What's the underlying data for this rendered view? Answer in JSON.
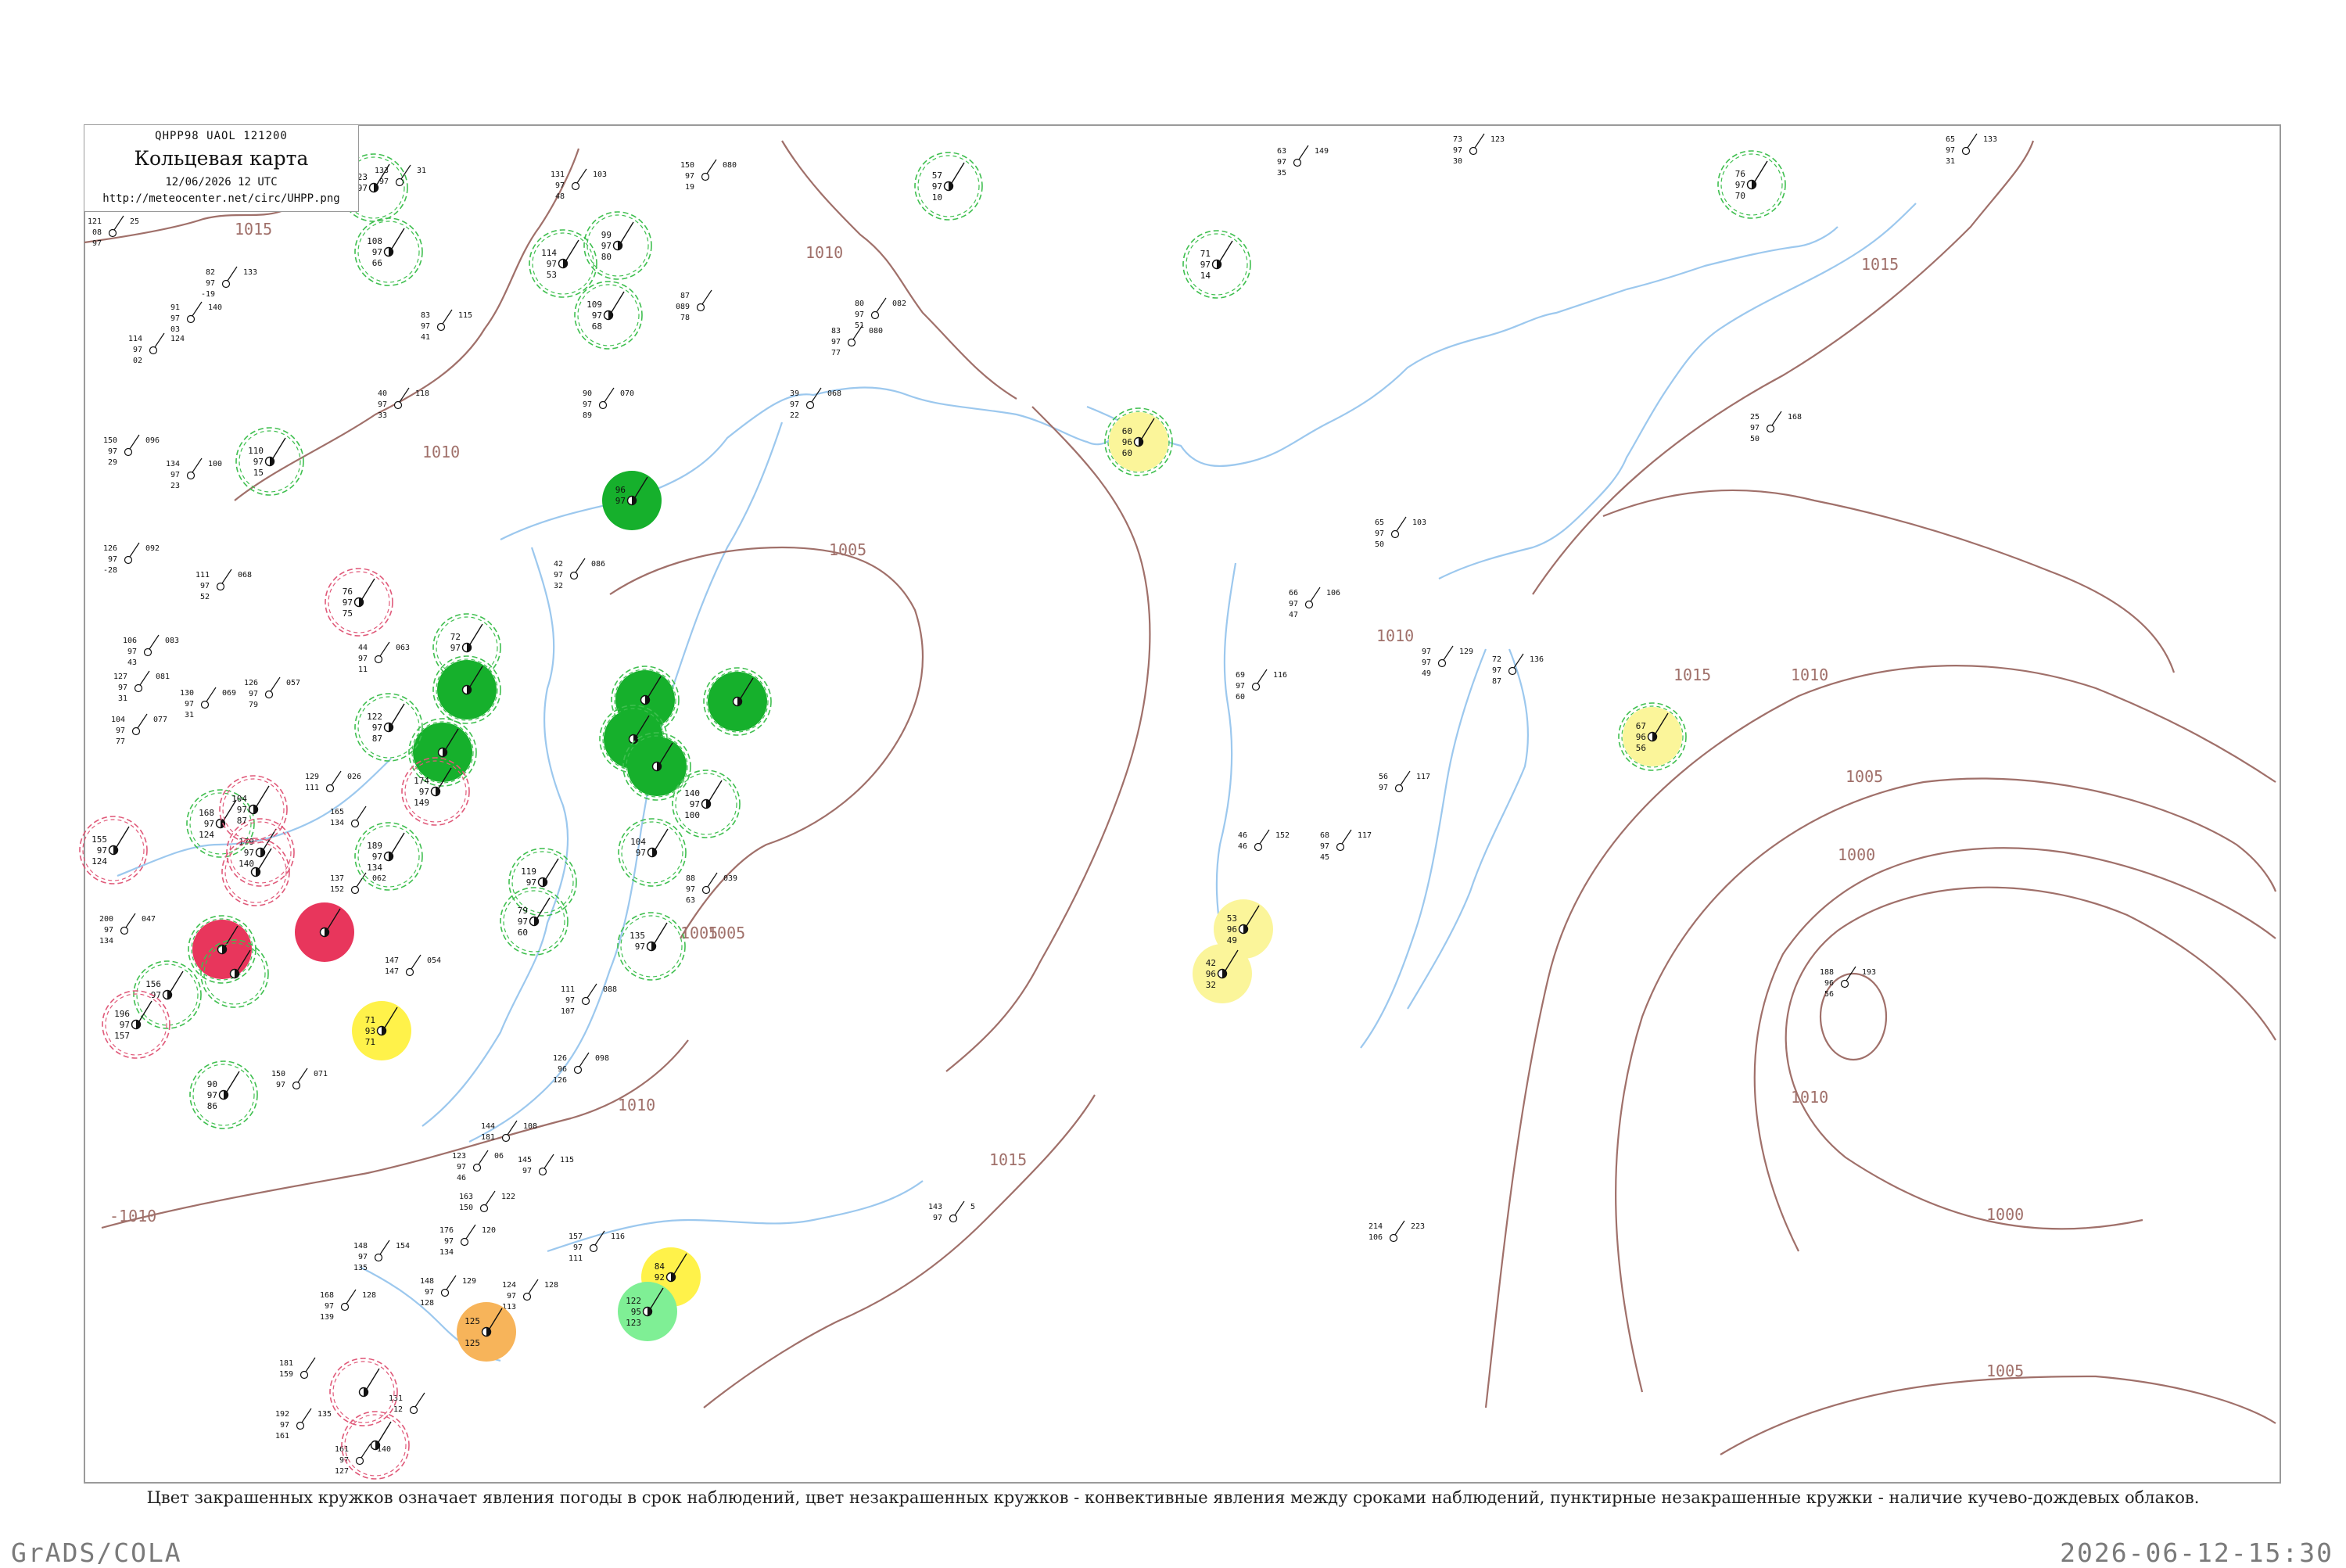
{
  "header": {
    "code": "QHPP98 UAOL 121200",
    "title": "Кольцевая карта",
    "datetime": "12/06/2026 12 UTC",
    "url": "http://meteocenter.net/circ/UHPP.png"
  },
  "caption": "Цвет закрашенных кружков означает явления погоды в срок наблюдений, цвет незакрашенных кружков - конвективные явления между сроками наблюдений, пунктирные незакрашенные кружки - наличие кучево-дождевых облаков.",
  "footer": {
    "software": "GrADS/COLA",
    "timestamp": "2026-06-12-15:30"
  },
  "colors": {
    "isobar": "#a0706a",
    "coast": "#9cc8ee",
    "frame": "#9a9a9a",
    "green": "#16b02c",
    "lime": "#7fef95",
    "yellow": "#fff24a",
    "paleyellow": "#fbf59a",
    "red": "#e8365c",
    "orange": "#f7b45a",
    "ring_green": "#3fbf4f",
    "ring_red": "#e05a7a"
  },
  "isobar_labels": [
    "1015",
    "1010",
    "1010",
    "1005",
    "1005",
    "1010",
    "1010",
    "1015",
    "1015",
    "1010",
    "1005",
    "1000",
    "1000",
    "1005",
    "1010",
    "-1010",
    "1015",
    "1005"
  ],
  "stations": [
    {
      "id": "a1",
      "t": "123",
      "p": "97",
      "d": "",
      "fill": "",
      "ring": "green"
    },
    {
      "id": "a2",
      "t": "108",
      "p": "97",
      "d": "66",
      "fill": "",
      "ring": "green"
    },
    {
      "id": "a3",
      "t": "99",
      "p": "97",
      "d": "80",
      "fill": "",
      "ring": "green"
    },
    {
      "id": "a4",
      "t": "114",
      "p": "97",
      "d": "53",
      "fill": "",
      "ring": "green"
    },
    {
      "id": "a5",
      "t": "109",
      "p": "97",
      "d": "68",
      "fill": "",
      "ring": "green"
    },
    {
      "id": "a6",
      "t": "57",
      "p": "97",
      "d": "10",
      "fill": "",
      "ring": "green"
    },
    {
      "id": "a7",
      "t": "71",
      "p": "97",
      "d": "14",
      "fill": "",
      "ring": "green"
    },
    {
      "id": "a8",
      "t": "76",
      "p": "97",
      "d": "70",
      "fill": "",
      "ring": "green"
    },
    {
      "id": "a9",
      "t": "110",
      "p": "97",
      "d": "15",
      "fill": "",
      "ring": "green"
    },
    {
      "id": "a10",
      "t": "60",
      "p": "96",
      "d": "60",
      "fill": "paleyellow",
      "ring": "green"
    },
    {
      "id": "a11",
      "t": "96",
      "p": "97",
      "d": "",
      "fill": "green",
      "ring": ""
    },
    {
      "id": "a12",
      "t": "76",
      "p": "97",
      "d": "75",
      "fill": "",
      "ring": "red"
    },
    {
      "id": "a13",
      "t": "72",
      "p": "97",
      "d": "",
      "fill": "",
      "ring": "green"
    },
    {
      "id": "a14",
      "t": "",
      "p": "",
      "d": "",
      "fill": "green",
      "ring": "green"
    },
    {
      "id": "a15",
      "t": "",
      "p": "",
      "d": "",
      "fill": "green",
      "ring": "green"
    },
    {
      "id": "a16",
      "t": "",
      "p": "",
      "d": "",
      "fill": "green",
      "ring": "green"
    },
    {
      "id": "a17",
      "t": "",
      "p": "",
      "d": "",
      "fill": "green",
      "ring": "green"
    },
    {
      "id": "a18",
      "t": "",
      "p": "",
      "d": "",
      "fill": "green",
      "ring": "green"
    },
    {
      "id": "a19",
      "t": "",
      "p": "",
      "d": "",
      "fill": "green",
      "ring": "green"
    },
    {
      "id": "a20",
      "t": "122",
      "p": "97",
      "d": "87",
      "fill": "",
      "ring": "green"
    },
    {
      "id": "a21",
      "t": "174",
      "p": "97",
      "d": "149",
      "fill": "",
      "ring": "red"
    },
    {
      "id": "a22",
      "t": "168",
      "p": "97",
      "d": "124",
      "fill": "",
      "ring": "green"
    },
    {
      "id": "a23",
      "t": "179",
      "p": "97",
      "d": "140",
      "fill": "",
      "ring": "red"
    },
    {
      "id": "a24",
      "t": "104",
      "p": "97",
      "d": "87",
      "fill": "",
      "ring": "red"
    },
    {
      "id": "a25",
      "t": "155",
      "p": "97",
      "d": "124",
      "fill": "",
      "ring": "red"
    },
    {
      "id": "a26",
      "t": "189",
      "p": "97",
      "d": "134",
      "fill": "",
      "ring": "green"
    },
    {
      "id": "a27",
      "t": "104",
      "p": "97",
      "d": "",
      "fill": "",
      "ring": "green"
    },
    {
      "id": "a28",
      "t": "119",
      "p": "97",
      "d": "",
      "fill": "",
      "ring": "green"
    },
    {
      "id": "a29",
      "t": "79",
      "p": "97",
      "d": "60",
      "fill": "",
      "ring": "green"
    },
    {
      "id": "a30",
      "t": "135",
      "p": "97",
      "d": "",
      "fill": "",
      "ring": "green"
    },
    {
      "id": "a31",
      "t": "140",
      "p": "97",
      "d": "100",
      "fill": "",
      "ring": "green"
    },
    {
      "id": "a32",
      "t": "",
      "p": "",
      "d": "",
      "fill": "red",
      "ring": "green"
    },
    {
      "id": "a33",
      "t": "",
      "p": "",
      "d": "",
      "fill": "red",
      "ring": ""
    },
    {
      "id": "a34",
      "t": "156",
      "p": "97",
      "d": "",
      "fill": "",
      "ring": "green"
    },
    {
      "id": "a35",
      "t": "196",
      "p": "97",
      "d": "157",
      "fill": "",
      "ring": "red"
    },
    {
      "id": "a36",
      "t": "71",
      "p": "93",
      "d": "71",
      "fill": "yellow",
      "ring": ""
    },
    {
      "id": "a37",
      "t": "90",
      "p": "97",
      "d": "86",
      "fill": "",
      "ring": "green"
    },
    {
      "id": "a38",
      "t": "53",
      "p": "96",
      "d": "49",
      "fill": "paleyellow",
      "ring": ""
    },
    {
      "id": "a39",
      "t": "42",
      "p": "96",
      "d": "32",
      "fill": "paleyellow",
      "ring": ""
    },
    {
      "id": "a40",
      "t": "67",
      "p": "96",
      "d": "56",
      "fill": "paleyellow",
      "ring": "green"
    },
    {
      "id": "a41",
      "t": "84",
      "p": "92",
      "d": "",
      "fill": "yellow",
      "ring": ""
    },
    {
      "id": "a42",
      "t": "122",
      "p": "95",
      "d": "123",
      "fill": "lime",
      "ring": ""
    },
    {
      "id": "a43",
      "t": "125",
      "p": "",
      "d": "125",
      "fill": "orange",
      "ring": ""
    },
    {
      "id": "a44",
      "t": "",
      "p": "",
      "d": "",
      "fill": "",
      "ring": "red"
    },
    {
      "id": "a45",
      "t": "",
      "p": "",
      "d": "",
      "fill": "",
      "ring": "red"
    },
    {
      "id": "a46",
      "t": "",
      "p": "",
      "d": "",
      "fill": "",
      "ring": "red"
    },
    {
      "id": "a47",
      "t": "",
      "p": "",
      "d": "",
      "fill": "",
      "ring": "green"
    }
  ],
  "plain_stations": [
    {
      "v": [
        "133",
        "97",
        "",
        "31"
      ]
    },
    {
      "v": [
        "121",
        "08",
        "97",
        "25"
      ]
    },
    {
      "v": [
        "82",
        "97",
        "-19",
        "133"
      ]
    },
    {
      "v": [
        "91",
        "97",
        "03",
        "140"
      ]
    },
    {
      "v": [
        "114",
        "97",
        "02",
        "124"
      ]
    },
    {
      "v": [
        "83",
        "97",
        "41",
        "115"
      ]
    },
    {
      "v": [
        "131",
        "97",
        "48",
        "103"
      ]
    },
    {
      "v": [
        "150",
        "97",
        "19",
        "080"
      ]
    },
    {
      "v": [
        "87",
        "089",
        "78",
        ""
      ]
    },
    {
      "v": [
        "80",
        "97",
        "51",
        "082"
      ]
    },
    {
      "v": [
        "83",
        "97",
        "77",
        "080"
      ]
    },
    {
      "v": [
        "90",
        "97",
        "89",
        "070"
      ]
    },
    {
      "v": [
        "39",
        "97",
        "22",
        "068"
      ]
    },
    {
      "v": [
        "40",
        "97",
        "33",
        "118"
      ]
    },
    {
      "v": [
        "150",
        "97",
        "29",
        "096"
      ]
    },
    {
      "v": [
        "134",
        "97",
        "23",
        "100"
      ]
    },
    {
      "v": [
        "63",
        "97",
        "35",
        "149"
      ]
    },
    {
      "v": [
        "73",
        "97",
        "30",
        "123"
      ]
    },
    {
      "v": [
        "65",
        "97",
        "31",
        "133"
      ]
    },
    {
      "v": [
        "25",
        "97",
        "50",
        "168"
      ]
    },
    {
      "v": [
        "65",
        "97",
        "50",
        "103"
      ]
    },
    {
      "v": [
        "66",
        "97",
        "47",
        "106"
      ]
    },
    {
      "v": [
        "97",
        "97",
        "49",
        "129"
      ]
    },
    {
      "v": [
        "72",
        "97",
        "87",
        "136"
      ]
    },
    {
      "v": [
        "69",
        "97",
        "60",
        "116"
      ]
    },
    {
      "v": [
        "56",
        "97",
        "",
        "117"
      ]
    },
    {
      "v": [
        "68",
        "97",
        "45",
        "117"
      ]
    },
    {
      "v": [
        "46",
        "46",
        "",
        "152"
      ]
    },
    {
      "v": [
        "126",
        "97",
        "-28",
        "092"
      ]
    },
    {
      "v": [
        "111",
        "97",
        "52",
        "068"
      ]
    },
    {
      "v": [
        "106",
        "97",
        "43",
        "083"
      ]
    },
    {
      "v": [
        "127",
        "97",
        "31",
        "081"
      ]
    },
    {
      "v": [
        "104",
        "97",
        "77",
        "077"
      ]
    },
    {
      "v": [
        "130",
        "97",
        "31",
        "069"
      ]
    },
    {
      "v": [
        "126",
        "97",
        "79",
        "057"
      ]
    },
    {
      "v": [
        "44",
        "97",
        "11",
        "063"
      ]
    },
    {
      "v": [
        "42",
        "97",
        "32",
        "086"
      ]
    },
    {
      "v": [
        "129",
        "111",
        "",
        "026"
      ]
    },
    {
      "v": [
        "165",
        "134",
        "",
        ""
      ]
    },
    {
      "v": [
        "137",
        "152",
        "",
        "062"
      ]
    },
    {
      "v": [
        "200",
        "97",
        "134",
        "047"
      ]
    },
    {
      "v": [
        "147",
        "147",
        "",
        "054"
      ]
    },
    {
      "v": [
        "111",
        "97",
        "107",
        "088"
      ]
    },
    {
      "v": [
        "126",
        "96",
        "126",
        "098"
      ]
    },
    {
      "v": [
        "88",
        "97",
        "63",
        "039"
      ]
    },
    {
      "v": [
        "144",
        "181",
        "",
        "108"
      ]
    },
    {
      "v": [
        "123",
        "97",
        "46",
        "06"
      ]
    },
    {
      "v": [
        "163",
        "150",
        "",
        "122"
      ]
    },
    {
      "v": [
        "145",
        "97",
        "",
        "115"
      ]
    },
    {
      "v": [
        "148",
        "97",
        "135",
        "154"
      ]
    },
    {
      "v": [
        "176",
        "97",
        "134",
        "120"
      ]
    },
    {
      "v": [
        "157",
        "97",
        "111",
        "116"
      ]
    },
    {
      "v": [
        "143",
        "97",
        "",
        "5"
      ]
    },
    {
      "v": [
        "214",
        "106",
        "",
        "223"
      ]
    },
    {
      "v": [
        "188",
        "96",
        "56",
        "193"
      ]
    },
    {
      "v": [
        "168",
        "97",
        "139",
        "128"
      ]
    },
    {
      "v": [
        "181",
        "159",
        "",
        ""
      ]
    },
    {
      "v": [
        "192",
        "97",
        "161",
        "135"
      ]
    },
    {
      "v": [
        "161",
        "97",
        "127",
        "140"
      ]
    },
    {
      "v": [
        "131",
        "12",
        "",
        ""
      ]
    },
    {
      "v": [
        "124",
        "97",
        "113",
        "128"
      ]
    },
    {
      "v": [
        "148",
        "97",
        "128",
        "129"
      ]
    },
    {
      "v": [
        "150",
        "97",
        "",
        "071"
      ]
    }
  ]
}
